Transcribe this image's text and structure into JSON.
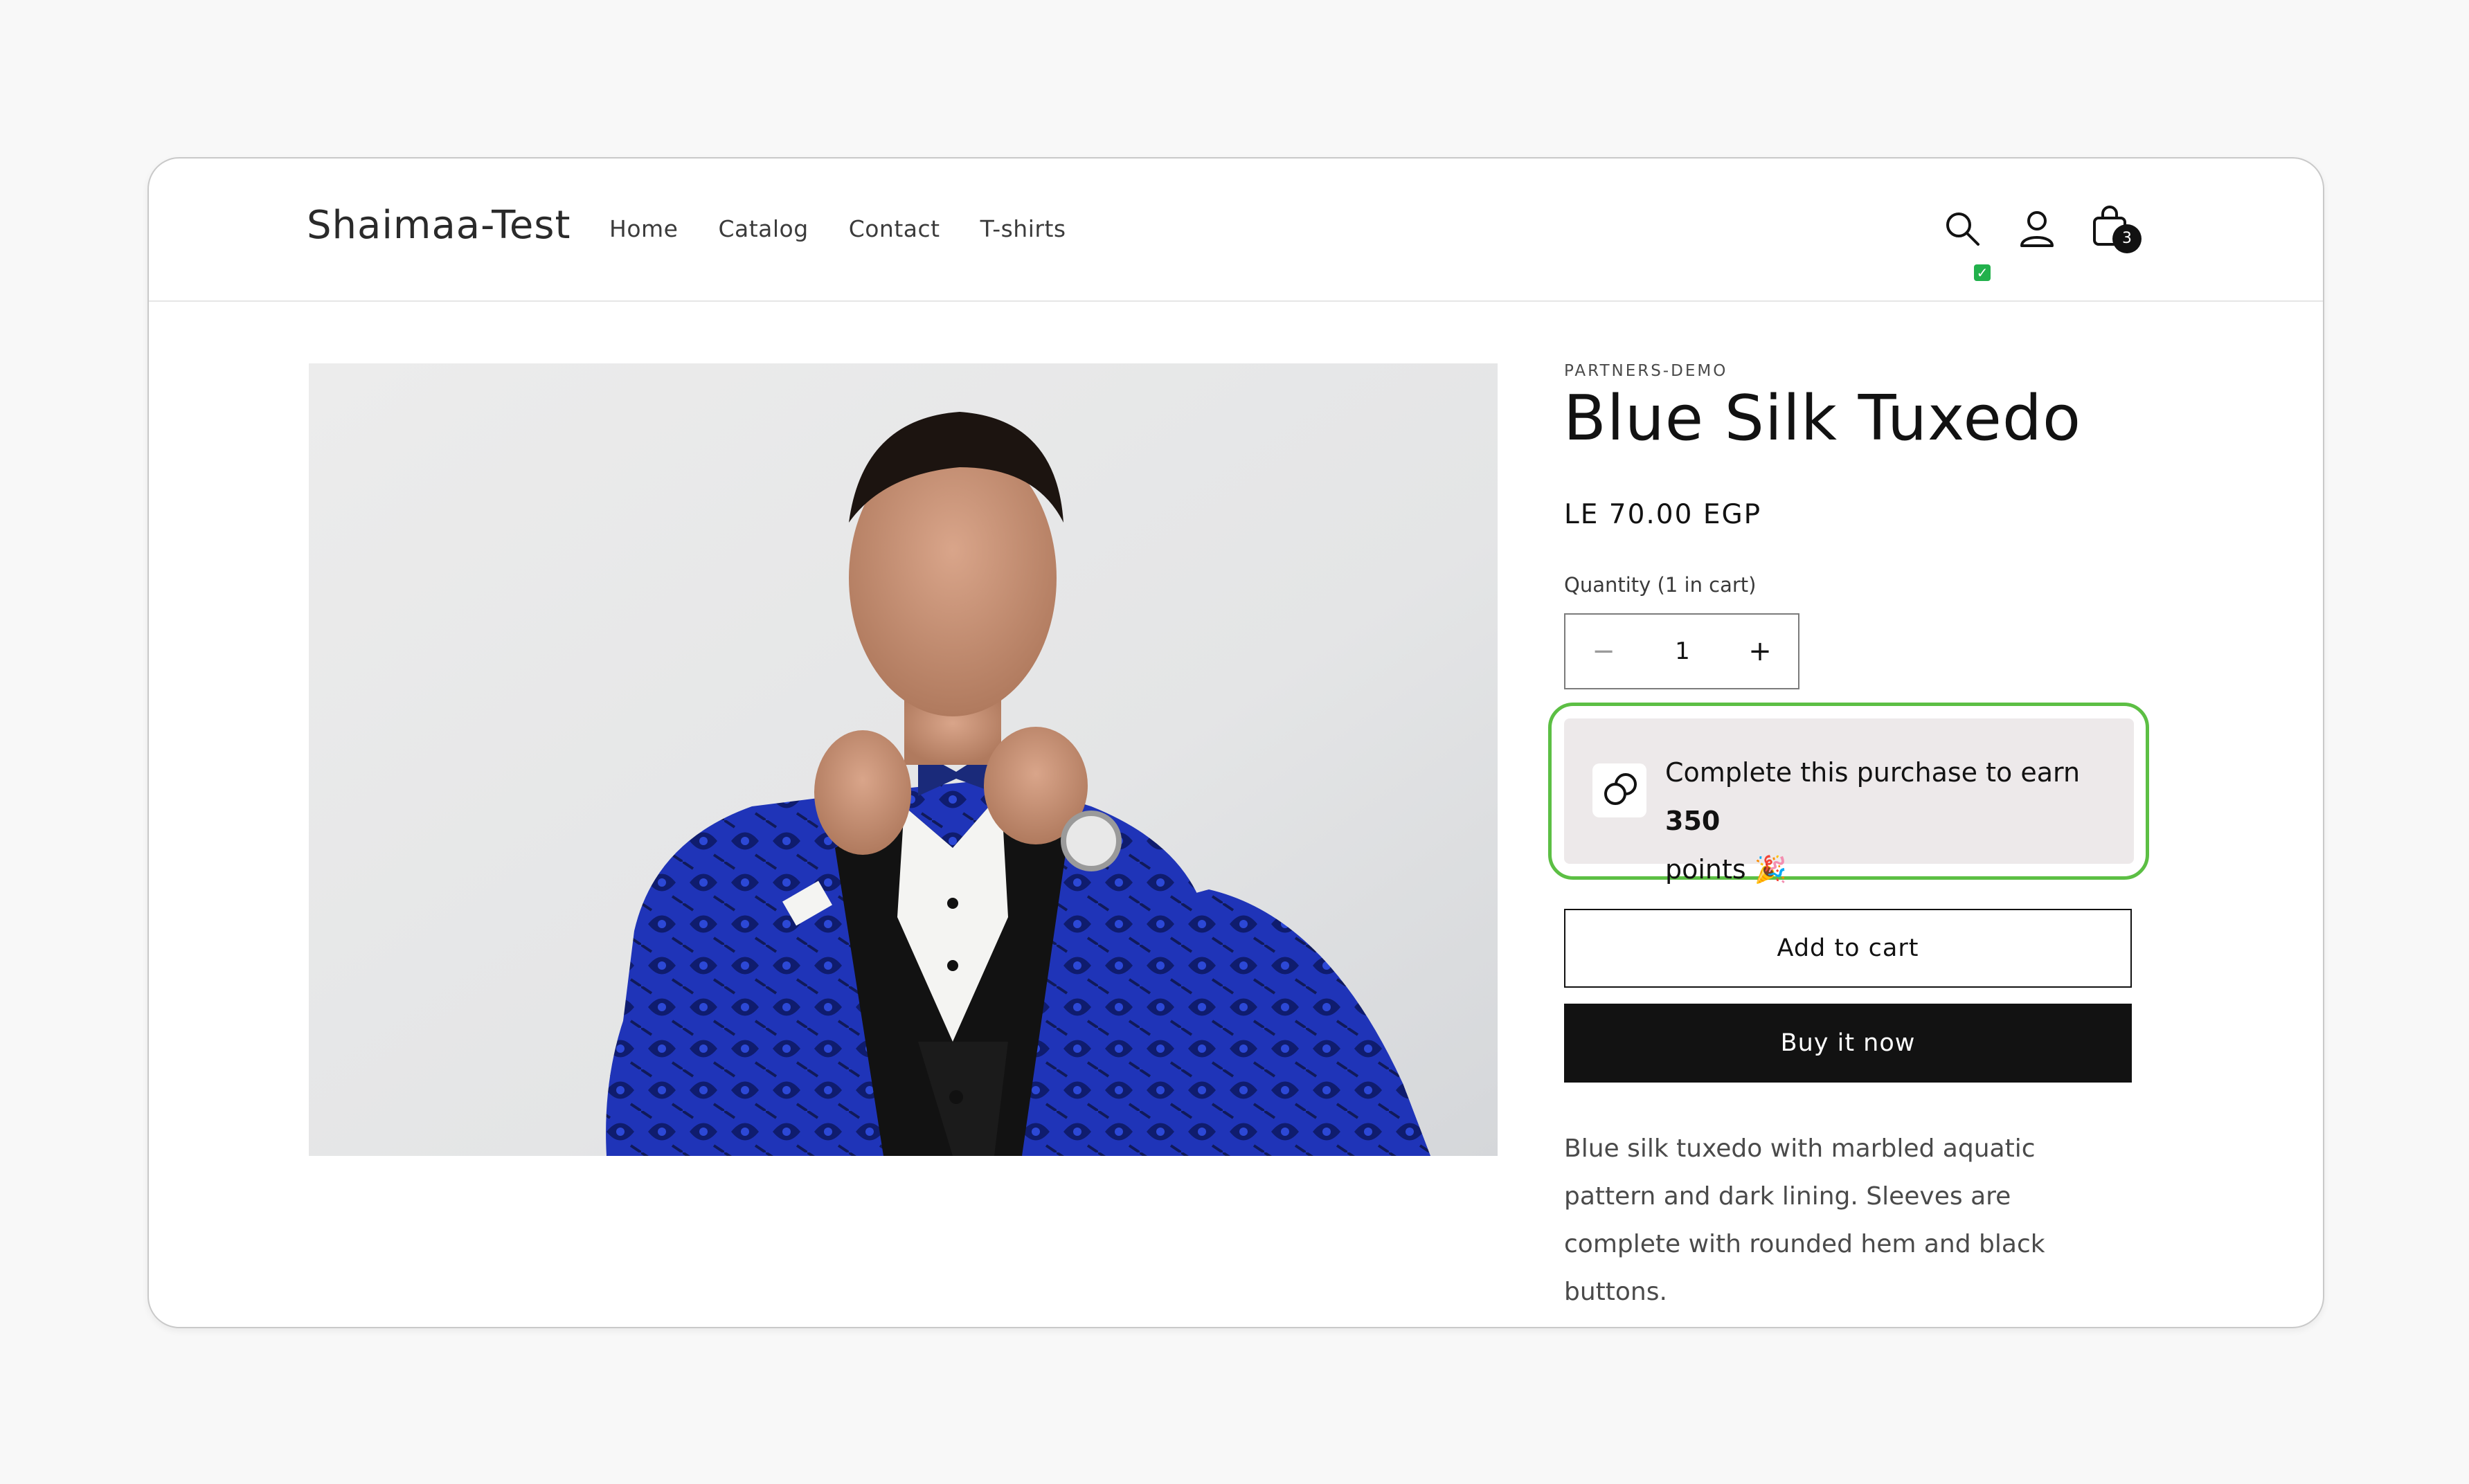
{
  "store": {
    "name": "Shaimaa-Test"
  },
  "nav": {
    "items": [
      "Home",
      "Catalog",
      "Contact",
      "T-shirts"
    ]
  },
  "header_icons": {
    "search": "search-icon",
    "account": "account-icon",
    "cart": "cart-icon",
    "cart_count": "3",
    "status": "✓"
  },
  "product": {
    "vendor": "PARTNERS-DEMO",
    "title": "Blue Silk Tuxedo",
    "price": "LE 70.00 EGP",
    "quantity_label": "Quantity (1 in cart)",
    "quantity_value": "1",
    "quantity_minus": "−",
    "quantity_plus": "+",
    "image_alt": "Man in blue silk tuxedo adjusting bow tie",
    "description": "Blue silk tuxedo with marbled aquatic pattern and dark lining. Sleeves are complete with rounded hem and black buttons."
  },
  "reward": {
    "text_before": "Complete this purchase to earn ",
    "points": "350",
    "text_after": "points",
    "emoji": "🎉",
    "icon": "coins-icon"
  },
  "buttons": {
    "add_to_cart": "Add to cart",
    "buy_now": "Buy it now"
  },
  "colors": {
    "reward_border": "#5cbf44",
    "reward_bg": "#ede9ea",
    "buy_button": "#121212"
  }
}
